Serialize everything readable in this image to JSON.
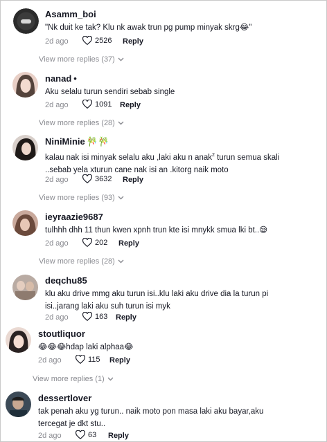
{
  "comments": [
    {
      "username": "Asamm_boi",
      "text": "\"Nk duit ke tak? Klu nk awak trun pg pump minyak skrg😂\"",
      "date": "2d ago",
      "likes": "2526",
      "reply_label": "Reply",
      "view_more": "View more replies (37)",
      "avatar_icon": "dark-circle-avatar"
    },
    {
      "username": "nanad",
      "username_suffix": "•",
      "text": "Aku selalu turun sendiri sebab single",
      "date": "2d ago",
      "likes": "1091",
      "reply_label": "Reply",
      "view_more": "View more replies (28)"
    },
    {
      "username": "NiniMinie",
      "username_extra": "🎋🎋",
      "text_line1_a": "kalau nak isi minyak selalu aku ,laki aku n anak",
      "text_line1_sup": "2",
      "text_line1_b": " turun semua skali",
      "text_line2": "..sebab yela xturun cane nak isi an .kitorg naik moto",
      "date": "2d ago",
      "likes": "3632",
      "reply_label": "Reply",
      "view_more": "View more replies (93)"
    },
    {
      "username": "ieyraazie9687",
      "text": "tulhhh dhh 11 thun kwen xpnh trun kte isi mnykk smua lki bt..😪",
      "date": "2d ago",
      "likes": "202",
      "reply_label": "Reply",
      "view_more": "View more replies (28)"
    },
    {
      "username": "deqchu85",
      "text_line1": "klu aku drive mmg aku turun isi..klu laki aku drive dia la turun pi",
      "text_line2": "isi..jarang laki aku suh turun isi myk",
      "date": "2d ago",
      "likes": "163",
      "reply_label": "Reply"
    },
    {
      "username": "stoutliquor",
      "text": "😂😂😂hdap laki alphaa😂",
      "date": "2d ago",
      "likes": "115",
      "reply_label": "Reply",
      "view_more": "View more replies (1)"
    },
    {
      "username": "dessertlover",
      "text_line1": "tak penah aku yg turun.. naik moto pon masa laki aku bayar,aku",
      "text_line2": "tercegat je dkt stu..",
      "date": "2d ago",
      "likes": "63",
      "reply_label": "Reply"
    }
  ]
}
